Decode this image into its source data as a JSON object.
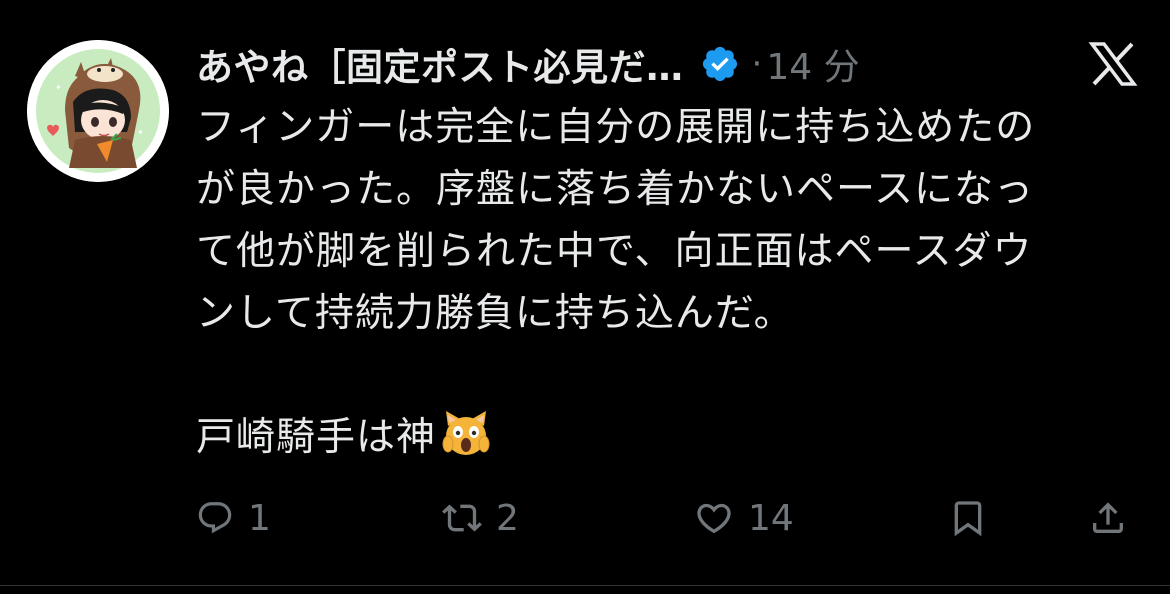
{
  "user": {
    "display_name": "あやね［固定ポスト必見だ…",
    "verified": true,
    "time_sep": "·",
    "time": "14 分"
  },
  "brand": {
    "logo_icon": "x-logo-icon"
  },
  "tweet": {
    "lines": [
      "フィンガーは完全に自分の展開に持ち込めたの",
      "が良かった。序盤に落ち着かないペースになっ",
      "て他が脚を削られた中で、向正面はペースダウ",
      "ンして持続力勝負に持ち込んだ。"
    ],
    "last_line": "戸崎騎手は神",
    "emoji": "face-screaming-cat-icon"
  },
  "actions": {
    "reply_count": "1",
    "repost_count": "2",
    "like_count": "14"
  },
  "colors": {
    "background": "#000000",
    "text_primary": "#e7e9ea",
    "text_secondary": "#71767b",
    "verified_blue": "#1d9bf0"
  }
}
